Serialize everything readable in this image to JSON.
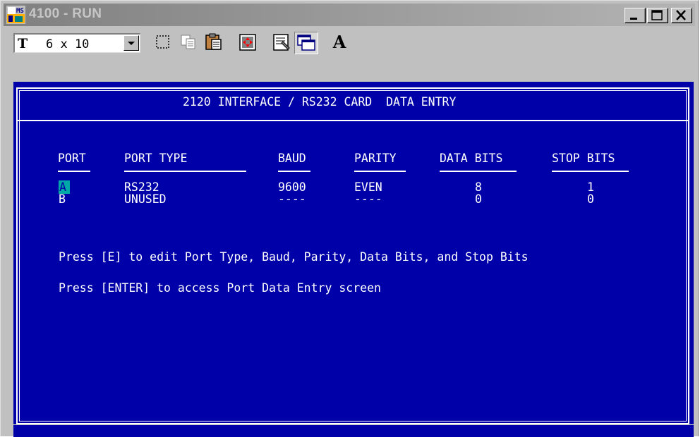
{
  "window": {
    "title": "4100 - RUN",
    "icon": "dos-app-icon",
    "controls": [
      "minimize-icon",
      "maximize-icon",
      "close-icon"
    ]
  },
  "toolbar": {
    "font_icon": "truetype-icon",
    "font_icon_text": "T",
    "font_size_value": "6 x 10",
    "buttons": [
      "mark-icon",
      "copy-icon",
      "paste-icon",
      "full-screen-icon",
      "properties-icon",
      "background-icon",
      "font-icon"
    ],
    "font_button_label": "A"
  },
  "screen": {
    "title": "2120 INTERFACE / RS232 CARD  DATA ENTRY",
    "columns": {
      "port": "PORT",
      "port_type": "PORT TYPE",
      "baud": "BAUD",
      "parity": "PARITY",
      "data_bits": "DATA BITS",
      "stop_bits": "STOP BITS"
    },
    "rows": [
      {
        "port": "A",
        "port_type": "RS232",
        "baud": "9600",
        "parity": "EVEN",
        "data_bits": "8",
        "stop_bits": "1",
        "selected": true
      },
      {
        "port": "B",
        "port_type": "UNUSED",
        "baud": "----",
        "parity": "----",
        "data_bits": "0",
        "stop_bits": "0",
        "selected": false
      }
    ],
    "help_line_1": "Press [E] to edit Port Type, Baud, Parity, Data Bits, and Stop Bits",
    "help_line_2": "Press [ENTER] to access Port Data Entry screen"
  },
  "colors": {
    "console_background": "#0000a8",
    "console_text": "#ffffff",
    "cursor_highlight": "#00a8a8",
    "window_chrome": "#c0c0c0"
  }
}
